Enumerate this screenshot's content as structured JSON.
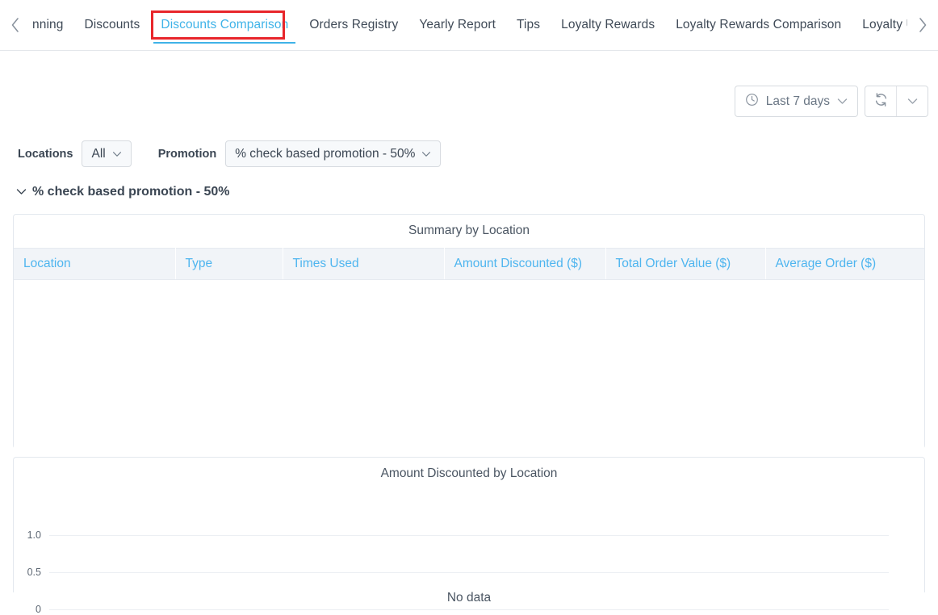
{
  "tabbar": {
    "prev_icon": "chevron-left-icon",
    "next_icon": "chevron-right-icon",
    "tabs": [
      {
        "label": "nning",
        "active": false,
        "truncated": true
      },
      {
        "label": "Discounts",
        "active": false
      },
      {
        "label": "Discounts Comparison",
        "active": true,
        "highlighted": true
      },
      {
        "label": "Orders Registry",
        "active": false
      },
      {
        "label": "Yearly Report",
        "active": false
      },
      {
        "label": "Tips",
        "active": false
      },
      {
        "label": "Loyalty Rewards",
        "active": false
      },
      {
        "label": "Loyalty Rewards Comparison",
        "active": false
      },
      {
        "label": "Loyalty Usage",
        "active": false
      }
    ],
    "active_color": "#3fb3e8",
    "highlight_color": "#e8262b"
  },
  "toolbar": {
    "date_range_label": "Last 7 days",
    "date_range_icon": "clock-icon",
    "date_range_caret": "chevron-down-icon",
    "refresh_icon": "refresh-icon",
    "refresh_caret": "chevron-down-icon"
  },
  "filters": {
    "locations_label": "Locations",
    "locations_value": "All",
    "promotion_label": "Promotion",
    "promotion_value": "% check based promotion - 50%",
    "caret_icon": "chevron-down-icon"
  },
  "section": {
    "collapse_icon": "chevron-down-icon",
    "title": "% check based promotion - 50%"
  },
  "table_card": {
    "title": "Summary by Location",
    "columns": [
      "Location",
      "Type",
      "Times Used",
      "Amount Discounted ($)",
      "Total Order Value ($)",
      "Average Order ($)"
    ],
    "rows": []
  },
  "chart_card": {
    "title": "Amount Discounted by Location",
    "empty_message": "No data"
  },
  "chart_data": {
    "type": "bar",
    "title": "Amount Discounted by Location",
    "categories": [],
    "values": [],
    "series": [],
    "xlabel": "",
    "ylabel": "",
    "ylim": [
      0,
      1.0
    ],
    "yticks": [
      "1.0",
      "0.5",
      "0"
    ],
    "grid": true,
    "legend": "none",
    "empty": true,
    "empty_message": "No data"
  }
}
